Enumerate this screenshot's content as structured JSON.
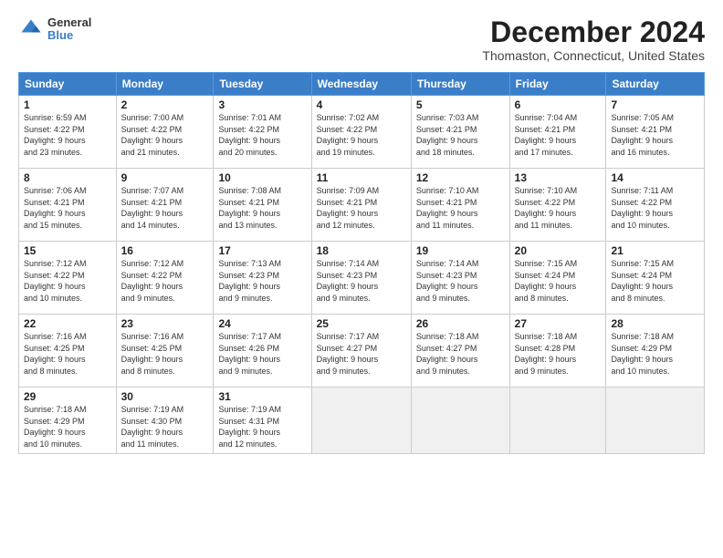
{
  "logo": {
    "general": "General",
    "blue": "Blue"
  },
  "title": "December 2024",
  "location": "Thomaston, Connecticut, United States",
  "days_header": [
    "Sunday",
    "Monday",
    "Tuesday",
    "Wednesday",
    "Thursday",
    "Friday",
    "Saturday"
  ],
  "weeks": [
    [
      {
        "day": "1",
        "info": "Sunrise: 6:59 AM\nSunset: 4:22 PM\nDaylight: 9 hours\nand 23 minutes."
      },
      {
        "day": "2",
        "info": "Sunrise: 7:00 AM\nSunset: 4:22 PM\nDaylight: 9 hours\nand 21 minutes."
      },
      {
        "day": "3",
        "info": "Sunrise: 7:01 AM\nSunset: 4:22 PM\nDaylight: 9 hours\nand 20 minutes."
      },
      {
        "day": "4",
        "info": "Sunrise: 7:02 AM\nSunset: 4:22 PM\nDaylight: 9 hours\nand 19 minutes."
      },
      {
        "day": "5",
        "info": "Sunrise: 7:03 AM\nSunset: 4:21 PM\nDaylight: 9 hours\nand 18 minutes."
      },
      {
        "day": "6",
        "info": "Sunrise: 7:04 AM\nSunset: 4:21 PM\nDaylight: 9 hours\nand 17 minutes."
      },
      {
        "day": "7",
        "info": "Sunrise: 7:05 AM\nSunset: 4:21 PM\nDaylight: 9 hours\nand 16 minutes."
      }
    ],
    [
      {
        "day": "8",
        "info": "Sunrise: 7:06 AM\nSunset: 4:21 PM\nDaylight: 9 hours\nand 15 minutes."
      },
      {
        "day": "9",
        "info": "Sunrise: 7:07 AM\nSunset: 4:21 PM\nDaylight: 9 hours\nand 14 minutes."
      },
      {
        "day": "10",
        "info": "Sunrise: 7:08 AM\nSunset: 4:21 PM\nDaylight: 9 hours\nand 13 minutes."
      },
      {
        "day": "11",
        "info": "Sunrise: 7:09 AM\nSunset: 4:21 PM\nDaylight: 9 hours\nand 12 minutes."
      },
      {
        "day": "12",
        "info": "Sunrise: 7:10 AM\nSunset: 4:21 PM\nDaylight: 9 hours\nand 11 minutes."
      },
      {
        "day": "13",
        "info": "Sunrise: 7:10 AM\nSunset: 4:22 PM\nDaylight: 9 hours\nand 11 minutes."
      },
      {
        "day": "14",
        "info": "Sunrise: 7:11 AM\nSunset: 4:22 PM\nDaylight: 9 hours\nand 10 minutes."
      }
    ],
    [
      {
        "day": "15",
        "info": "Sunrise: 7:12 AM\nSunset: 4:22 PM\nDaylight: 9 hours\nand 10 minutes."
      },
      {
        "day": "16",
        "info": "Sunrise: 7:12 AM\nSunset: 4:22 PM\nDaylight: 9 hours\nand 9 minutes."
      },
      {
        "day": "17",
        "info": "Sunrise: 7:13 AM\nSunset: 4:23 PM\nDaylight: 9 hours\nand 9 minutes."
      },
      {
        "day": "18",
        "info": "Sunrise: 7:14 AM\nSunset: 4:23 PM\nDaylight: 9 hours\nand 9 minutes."
      },
      {
        "day": "19",
        "info": "Sunrise: 7:14 AM\nSunset: 4:23 PM\nDaylight: 9 hours\nand 9 minutes."
      },
      {
        "day": "20",
        "info": "Sunrise: 7:15 AM\nSunset: 4:24 PM\nDaylight: 9 hours\nand 8 minutes."
      },
      {
        "day": "21",
        "info": "Sunrise: 7:15 AM\nSunset: 4:24 PM\nDaylight: 9 hours\nand 8 minutes."
      }
    ],
    [
      {
        "day": "22",
        "info": "Sunrise: 7:16 AM\nSunset: 4:25 PM\nDaylight: 9 hours\nand 8 minutes."
      },
      {
        "day": "23",
        "info": "Sunrise: 7:16 AM\nSunset: 4:25 PM\nDaylight: 9 hours\nand 8 minutes."
      },
      {
        "day": "24",
        "info": "Sunrise: 7:17 AM\nSunset: 4:26 PM\nDaylight: 9 hours\nand 9 minutes."
      },
      {
        "day": "25",
        "info": "Sunrise: 7:17 AM\nSunset: 4:27 PM\nDaylight: 9 hours\nand 9 minutes."
      },
      {
        "day": "26",
        "info": "Sunrise: 7:18 AM\nSunset: 4:27 PM\nDaylight: 9 hours\nand 9 minutes."
      },
      {
        "day": "27",
        "info": "Sunrise: 7:18 AM\nSunset: 4:28 PM\nDaylight: 9 hours\nand 9 minutes."
      },
      {
        "day": "28",
        "info": "Sunrise: 7:18 AM\nSunset: 4:29 PM\nDaylight: 9 hours\nand 10 minutes."
      }
    ],
    [
      {
        "day": "29",
        "info": "Sunrise: 7:18 AM\nSunset: 4:29 PM\nDaylight: 9 hours\nand 10 minutes."
      },
      {
        "day": "30",
        "info": "Sunrise: 7:19 AM\nSunset: 4:30 PM\nDaylight: 9 hours\nand 11 minutes."
      },
      {
        "day": "31",
        "info": "Sunrise: 7:19 AM\nSunset: 4:31 PM\nDaylight: 9 hours\nand 12 minutes."
      },
      {
        "day": "",
        "info": ""
      },
      {
        "day": "",
        "info": ""
      },
      {
        "day": "",
        "info": ""
      },
      {
        "day": "",
        "info": ""
      }
    ]
  ]
}
